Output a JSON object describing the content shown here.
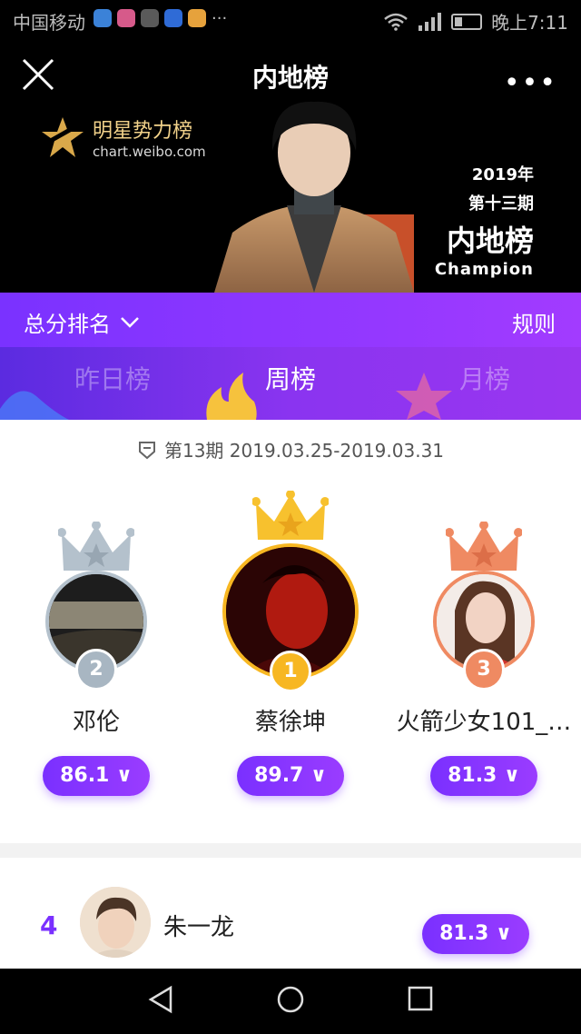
{
  "status_bar": {
    "carrier": "中国移动",
    "notification_dots": "···",
    "time": "晚上7:11"
  },
  "header": {
    "title": "内地榜"
  },
  "banner": {
    "brand_name": "明星势力榜",
    "brand_url": "chart.weibo.com",
    "year": "2019年",
    "issue": "第十三期",
    "board": "内地榜",
    "champion_label": "Champion"
  },
  "rank_bar": {
    "sort_label": "总分排名",
    "rules_label": "规则"
  },
  "tabs": [
    {
      "label": "昨日榜"
    },
    {
      "label": "周榜"
    },
    {
      "label": "月榜"
    }
  ],
  "period": {
    "text": "第13期 2019.03.25-2019.03.31"
  },
  "podium": [
    {
      "rank": "2",
      "name": "邓伦",
      "score": "86.1"
    },
    {
      "rank": "1",
      "name": "蔡徐坤",
      "score": "89.7"
    },
    {
      "rank": "3",
      "name": "火箭少女101_…",
      "score": "81.3"
    }
  ],
  "list": [
    {
      "rank": "4",
      "name": "朱一龙",
      "score": "81.3"
    }
  ],
  "colors": {
    "accent": "#7a30ff",
    "gold": "#f7b722",
    "silver": "#b4c1cc",
    "bronze": "#ef8a62"
  }
}
